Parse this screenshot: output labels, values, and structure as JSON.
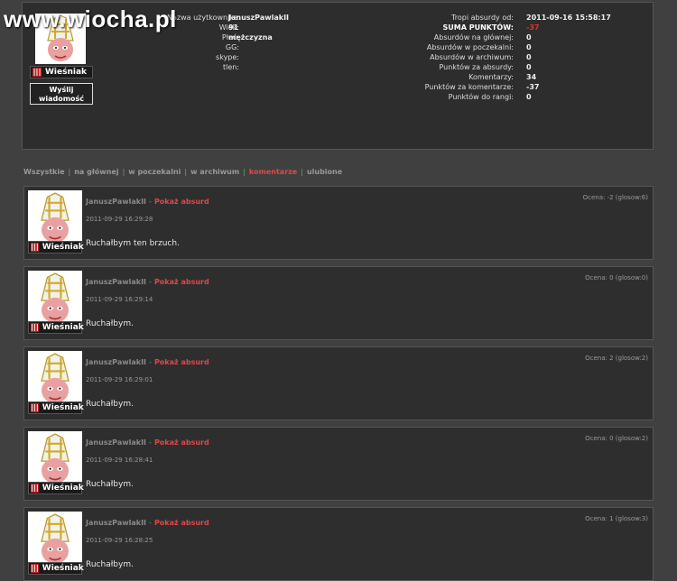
{
  "watermark": "www.wiocha.pl",
  "profile": {
    "rank": "Wieśniak",
    "send_message": "Wyślij wiadomość",
    "left_labels": [
      "Nazwa użytkownika:",
      "Wiek:",
      "Płeć:",
      "GG:",
      "skype:",
      "tlen:"
    ],
    "left_values": [
      "JanuszPawlakII",
      "91",
      "mężczyzna",
      "",
      "",
      ""
    ],
    "right_labels": [
      "Tropi absurdy od:",
      "SUMA PUNKTÓW:",
      "Absurdów na głównej:",
      "Absurdów w poczekalni:",
      "Absurdów w archiwum:",
      "Punktów za absurdy:",
      "Komentarzy:",
      "Punktów za komentarze:",
      "Punktów do rangi:"
    ],
    "right_values": [
      "2011-09-16 15:58:17",
      "-37",
      "0",
      "0",
      "0",
      "0",
      "34",
      "-37",
      "0"
    ]
  },
  "filters": [
    "Wszystkie",
    "na głównej",
    "w poczekalni",
    "w archiwum",
    "komentarze",
    "ulubione"
  ],
  "comments": [
    {
      "author": "JanuszPawlakII",
      "link": "Pokaż absurd",
      "date": "2011-09-29 16:29:28",
      "text": "Ruchałbym ten brzuch.",
      "rating": "Ocena: -2 (glosow:6)"
    },
    {
      "author": "JanuszPawlakII",
      "link": "Pokaż absurd",
      "date": "2011-09-29 16:29:14",
      "text": "Ruchałbym.",
      "rating": "Ocena: 0 (glosow:0)"
    },
    {
      "author": "JanuszPawlakII",
      "link": "Pokaż absurd",
      "date": "2011-09-29 16:29:01",
      "text": "Ruchałbym.",
      "rating": "Ocena: 2 (glosow:2)"
    },
    {
      "author": "JanuszPawlakII",
      "link": "Pokaż absurd",
      "date": "2011-09-29 16:28:41",
      "text": "Ruchałbym.",
      "rating": "Ocena: 0 (glosow:2)"
    },
    {
      "author": "JanuszPawlakII",
      "link": "Pokaż absurd",
      "date": "2011-09-29 16:28:25",
      "text": "Ruchałbym.",
      "rating": "Ocena: 1 (glosow:3)"
    }
  ],
  "colors": {
    "page_bg": "#404040",
    "panel_bg": "#2e2e2e",
    "accent_red": "#e04848",
    "filter_separator": "#66aa66"
  }
}
